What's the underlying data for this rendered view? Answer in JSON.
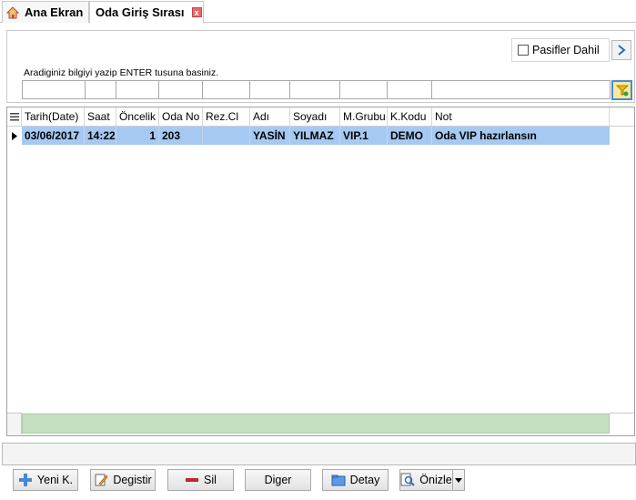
{
  "tabs": [
    {
      "label": "Ana Ekran"
    },
    {
      "label": "Oda Giriş Sırası",
      "close": "x"
    }
  ],
  "search": {
    "pasif_label": "Pasifler Dahil",
    "hint": "Aradiginiz bilgiyi yazip ENTER tusuna basiniz.",
    "filters": [
      "",
      "",
      "",
      "",
      "",
      "",
      "",
      "",
      "",
      ""
    ]
  },
  "grid": {
    "columns": [
      "Tarih(Date)",
      "Saat",
      "Öncelik",
      "Oda No",
      "Rez.Cl",
      "Adı",
      "Soyadı",
      "M.Grubu",
      "K.Kodu",
      "Not"
    ],
    "rows": [
      [
        "03/06/2017",
        "14:22",
        "1",
        "203",
        "",
        "YASİN",
        "YILMAZ",
        "VIP.1",
        "DEMO",
        "Oda VIP hazırlansın"
      ]
    ]
  },
  "buttons": {
    "new": "Yeni K.",
    "edit": "Degistir",
    "delete": "Sil",
    "other": "Diger",
    "detail": "Detay",
    "preview": "Önizle"
  },
  "colors": {
    "selected_row": "#a6c9f2",
    "footer": "#c5e0c1",
    "accent": "#3d8fd6"
  }
}
